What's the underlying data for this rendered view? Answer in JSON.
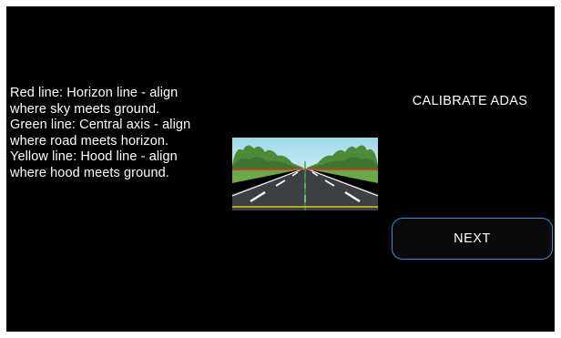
{
  "instructions": {
    "lines": [
      "Red line: Horizon line - align",
      "where sky meets ground.",
      "Green line: Central axis - align",
      "where road meets horizon.",
      "Yellow line: Hood line - align",
      "where hood meets ground."
    ]
  },
  "calibrate": {
    "title": "CALIBRATE ADAS"
  },
  "buttons": {
    "next_label": "NEXT"
  },
  "colors": {
    "screen_background": "#000000",
    "button_border": "#3b8fd0",
    "horizon_line": "#e03020",
    "central_axis": "#3aa040",
    "hood_line": "#e8c020"
  },
  "image": {
    "icon": "road-calibration-illustration"
  }
}
